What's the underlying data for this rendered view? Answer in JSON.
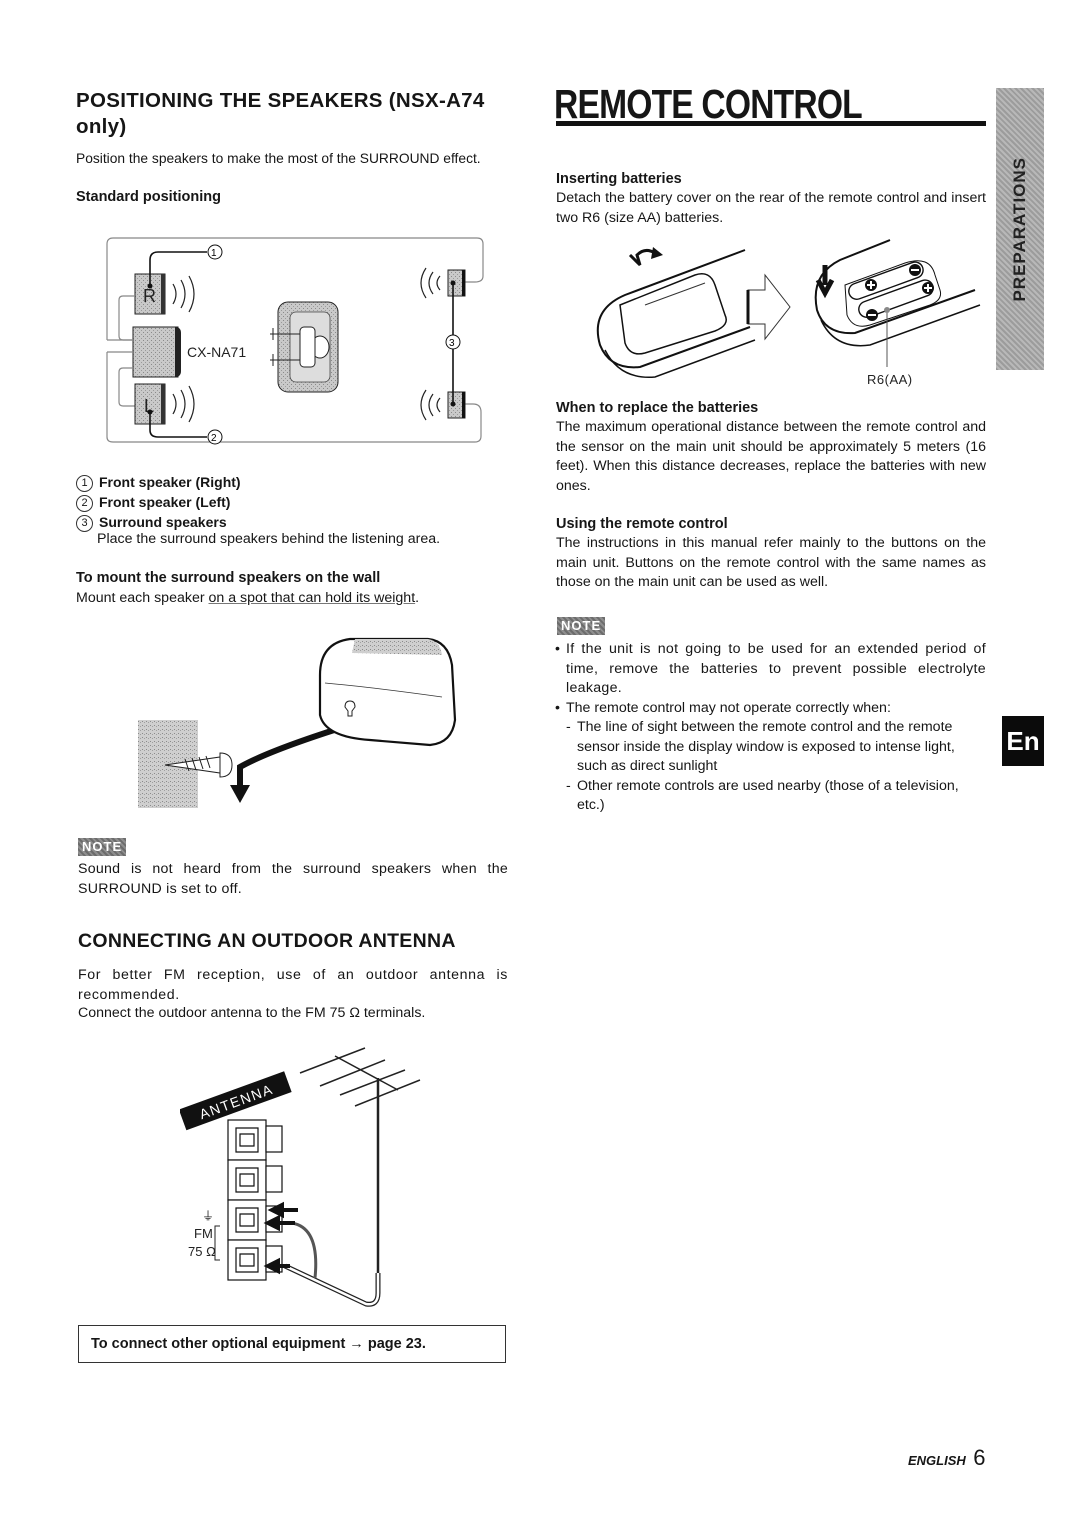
{
  "left": {
    "positioning": {
      "title": "POSITIONING THE SPEAKERS (NSX-A74 only)",
      "intro": "Position the speakers to make the most of the SURROUND effect.",
      "standard_heading": "Standard positioning",
      "diagram": {
        "speaker_right_label": "R",
        "speaker_left_label": "L",
        "center_unit_label": "CX-NA71",
        "callout_1": "1",
        "callout_2": "2",
        "callout_3": "3"
      },
      "legend": [
        {
          "num": "1",
          "label": "Front speaker (Right)"
        },
        {
          "num": "2",
          "label": "Front speaker (Left)"
        },
        {
          "num": "3",
          "label": "Surround speakers"
        }
      ],
      "surround_desc": "Place the surround speakers behind the listening area.",
      "mount_heading": "To mount the surround speakers on the wall",
      "mount_text_pre": "Mount each speaker ",
      "mount_text_underlined": "on a spot that can hold its weight",
      "mount_text_post": "."
    },
    "note": {
      "badge": "NOTE",
      "text": "Sound is not heard from the surround speakers when the SURROUND is set to off."
    },
    "antenna": {
      "title": "CONNECTING AN OUTDOOR ANTENNA",
      "p1": "For better FM reception, use of an outdoor antenna is recommended.",
      "p2": "Connect the outdoor antenna to the FM 75 Ω terminals.",
      "diagram": {
        "antenna_label": "ANTENNA",
        "ground_symbol": "⏚",
        "fm_label": "FM",
        "ohm_label": "75 Ω"
      }
    },
    "cross_ref": "To connect other optional equipment → page 23."
  },
  "right": {
    "title": "REMOTE CONTROL",
    "inserting": {
      "heading": "Inserting batteries",
      "text": "Detach the battery cover on the rear of the remote control and insert two R6 (size AA) batteries.",
      "battery_label": "R6(AA)"
    },
    "replace": {
      "heading": "When to replace the batteries",
      "text": "The maximum operational distance between the remote control and the sensor on the main unit should be approximately 5 meters (16 feet).  When this distance decreases, replace the batteries with new ones."
    },
    "using": {
      "heading": "Using the remote control",
      "text": "The instructions in this manual refer mainly to the buttons on the main unit. Buttons on the remote control with the same names as those on the main unit can be used as well."
    },
    "note": {
      "badge": "NOTE",
      "items": [
        "If the unit is not going to be used for an extended period of time, remove the batteries to prevent possible electrolyte leakage.",
        "The remote control may not operate correctly when:"
      ],
      "subitems": [
        "The line of sight between the remote control and the remote sensor inside the display window is exposed to intense light, such as direct sunlight",
        "Other remote controls are used nearby (those of  a television, etc.)"
      ]
    }
  },
  "side_tabs": {
    "section": "PREPARATIONS",
    "language": "En"
  },
  "footer": {
    "language": "ENGLISH",
    "page_number": "6"
  }
}
